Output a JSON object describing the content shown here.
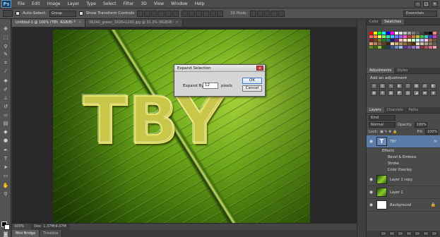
{
  "app": {
    "logo": "Ps"
  },
  "menu": [
    "File",
    "Edit",
    "Image",
    "Layer",
    "Type",
    "Select",
    "Filter",
    "3D",
    "View",
    "Window",
    "Help"
  ],
  "window_controls": [
    "–",
    "□",
    "×"
  ],
  "options_bar": {
    "auto_select_label": "Auto-Select:",
    "auto_select_value": "Group",
    "show_transform_label": "Show Transform Controls",
    "mode_3d_label": "3D Mode:",
    "workspace": "Essentials"
  },
  "tabs": [
    {
      "label": "Untitled-1 @ 100% (TBY, RGB/8) *",
      "close": "×"
    },
    {
      "label": "06240_green_1920x1200.jpg @ 31.3% (RGB/8)",
      "close": "×"
    }
  ],
  "canvas": {
    "text": "TBY"
  },
  "status": {
    "zoom": "100%",
    "doc": "Doc: 1.37M/4.07M"
  },
  "bottom_tabs": [
    "Mini Bridge",
    "Timeline"
  ],
  "dialog": {
    "title": "Expand Selection",
    "close": "x",
    "expand_label": "Expand By:",
    "expand_value": "12",
    "unit": "pixels",
    "ok": "OK",
    "cancel": "Cancel"
  },
  "panels": {
    "color_tabs": [
      "Color",
      "Swatches"
    ],
    "adjustments_tabs": [
      "Adjustments",
      "Styles"
    ],
    "add_adjustment": "Add an adjustment",
    "layers_tabs": [
      "Layers",
      "Channels",
      "Paths"
    ],
    "kind": "Kind",
    "blend_mode": "Normal",
    "opacity_label": "Opacity:",
    "opacity_value": "100%",
    "lock_label": "Lock:",
    "fill_label": "Fill:",
    "fill_value": "100%",
    "layers": [
      {
        "name": "TBY",
        "thumb": "T",
        "kind": "text",
        "fx": "fx",
        "selected": true
      },
      {
        "name": "Layer 1 copy",
        "kind": "leaf"
      },
      {
        "name": "Layer 1",
        "kind": "leaf"
      },
      {
        "name": "Background",
        "kind": "white",
        "lock": "🔒"
      }
    ],
    "effects_header": "Effects",
    "effects": [
      "Bevel & Emboss",
      "Stroke",
      "Color Overlay"
    ]
  },
  "colors": {
    "swatches": [
      "#ff0000",
      "#ffff00",
      "#00ff00",
      "#00ffff",
      "#0000ff",
      "#ff00ff",
      "#ffffff",
      "#e0e0e0",
      "#c0c0c0",
      "#a0a0a0",
      "#808080",
      "#606060",
      "#404040",
      "#202020",
      "#000000",
      "#ff8080",
      "#ff6060",
      "#ff9040",
      "#fff060",
      "#80ff60",
      "#40e0a0",
      "#40c0ff",
      "#6080ff",
      "#a060ff",
      "#ff60c0",
      "#c04040",
      "#c08040",
      "#c0c040",
      "#40c040",
      "#40c0c0",
      "#4040c0",
      "#c040c0",
      "#802020",
      "#804020",
      "#808020",
      "#208020",
      "#208080",
      "#202080",
      "#802080",
      "#ffc0c0",
      "#ffe0c0",
      "#ffffc0",
      "#c0ffc0",
      "#c0ffff",
      "#c0c0ff",
      "#ffc0ff",
      "#a07050",
      "#705030",
      "#e0a080",
      "#c08060",
      "#906040",
      "#604020",
      "#402010",
      "#f0d0a0",
      "#d0b080",
      "#b09060",
      "#907040",
      "#705020",
      "#503010",
      "#e8e0c8",
      "#c8c0a8",
      "#a8a088",
      "#888068",
      "#686048",
      "#5c8c20",
      "#3c6c10",
      "#8cbc40",
      "#2c4c08",
      "#1c3c60",
      "#3c5c90",
      "#6c8cc0",
      "#9cbce0",
      "#603c80",
      "#80509c",
      "#a070c0",
      "#c0a0e0",
      "#90303c",
      "#b05060",
      "#d07080",
      "#f0a0b0"
    ]
  }
}
